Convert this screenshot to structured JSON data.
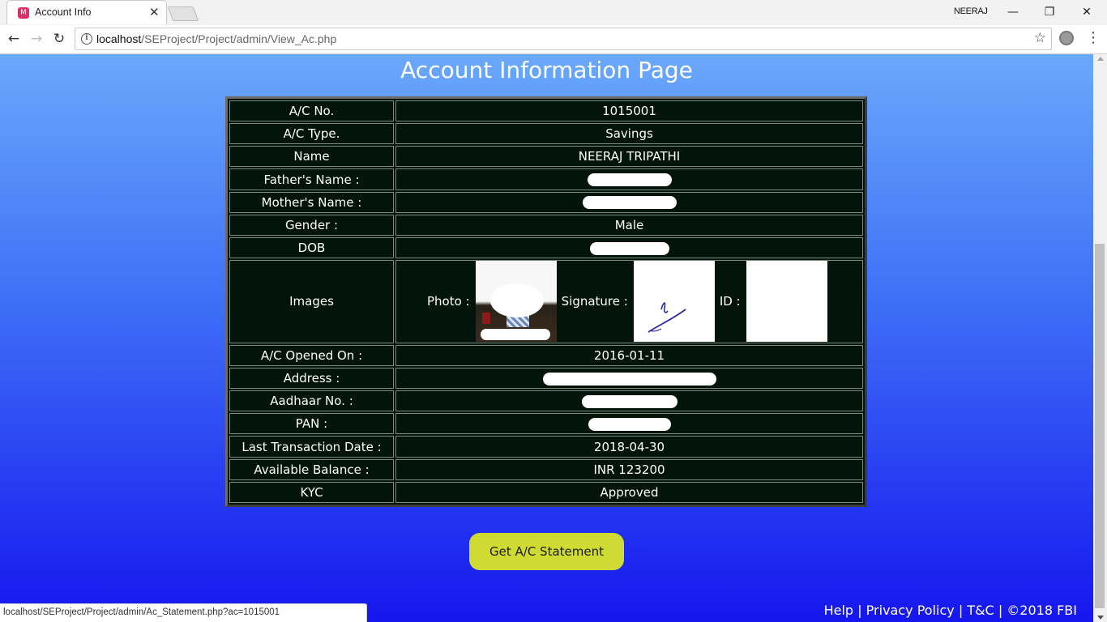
{
  "browser": {
    "tab_title": "Account Info",
    "tab_favicon": "tab-favicon-icon",
    "user_name": "NEERAJ",
    "url_host": "localhost",
    "url_path": "/SEProject/Project/admin/View_Ac.php",
    "status_url": "localhost/SEProject/Project/admin/Ac_Statement.php?ac=1015001"
  },
  "page": {
    "title": "Account Information Page",
    "rows": [
      {
        "label": "A/C No.",
        "value": "1015001"
      },
      {
        "label": "A/C Type.",
        "value": "Savings"
      },
      {
        "label": "Name",
        "value": "NEERAJ TRIPATHI"
      },
      {
        "label": "Father's Name :",
        "value": ""
      },
      {
        "label": "Mother's Name :",
        "value": ""
      },
      {
        "label": "Gender :",
        "value": "Male"
      },
      {
        "label": "DOB",
        "value": ""
      }
    ],
    "images_row": {
      "label": "Images",
      "photo_label": "Photo :",
      "signature_label": "Signature :",
      "id_label": "ID :"
    },
    "rows_after": [
      {
        "label": "A/C Opened On :",
        "value": "2016-01-11"
      },
      {
        "label": "Address :",
        "value": ""
      },
      {
        "label": "Aadhaar No. :",
        "value": ""
      },
      {
        "label": "PAN :",
        "value": ""
      },
      {
        "label": "Last Transaction Date :",
        "value": "2018-04-30"
      },
      {
        "label": "Available Balance :",
        "value": "INR 123200"
      },
      {
        "label": "KYC",
        "value": "Approved"
      }
    ],
    "statement_button": "Get A/C Statement",
    "footer": {
      "help": "Help",
      "sep1": "|",
      "privacy": "Privacy Policy",
      "sep2": "|",
      "tnc": "T&C",
      "sep3": "|",
      "copyright": "©2018 FBI"
    }
  },
  "colors": {
    "gradient_top": "#6aa8fb",
    "gradient_bottom": "#1616ee",
    "table_bg": "#03140a",
    "button_bg": "#cfdb32"
  }
}
